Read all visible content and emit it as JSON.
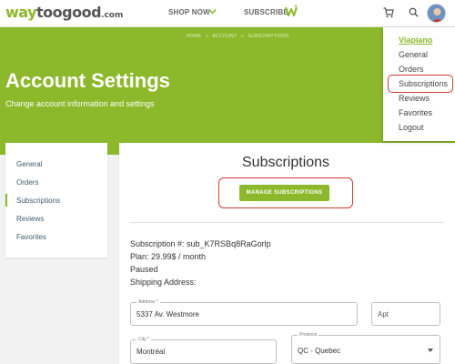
{
  "header": {
    "logo": {
      "part1": "way",
      "part2": "toogood",
      "part3": ".com"
    },
    "nav": {
      "shop_now": "SHOP NOW",
      "subscribe": "SUBSCRIBE"
    },
    "icons": [
      "chevron-down-icon",
      "subscribe-w-icon",
      "cart-icon",
      "search-icon",
      "avatar"
    ]
  },
  "banner": {
    "breadcrumb": [
      "HOME",
      "»",
      "ACCOUNT",
      "»",
      "SUBSCRIPTIONS"
    ],
    "title": "Account Settings",
    "subtitle": "Change account information and settings"
  },
  "dropdown": {
    "user": "Viapiano",
    "items": [
      "General",
      "Orders",
      "Subscriptions",
      "Reviews",
      "Favorites",
      "Logout"
    ],
    "highlighted": "Subscriptions"
  },
  "side_nav": {
    "items": [
      "General",
      "Orders",
      "Subscriptions",
      "Reviews",
      "Favorites"
    ],
    "active": "Subscriptions"
  },
  "panel": {
    "title": "Subscriptions",
    "manage_button": "MANAGE SUBSCRIPTIONS",
    "subscription_number": "Subscription #: sub_K7RSBq8RaGorlp",
    "plan": "Plan: 29.99$ / month",
    "status": "Paused",
    "shipping_label": "Shipping Address:"
  },
  "form": {
    "address": {
      "label": "Address *",
      "value": "5337 Av. Westmore"
    },
    "apt": {
      "label": "",
      "value": "Apt"
    },
    "city": {
      "label": "City *",
      "value": "Montréal"
    },
    "province": {
      "label": "Province",
      "value": "QC - Quebec"
    }
  },
  "colors": {
    "brand_green": "#8cb82b",
    "highlight_red": "#d23a2e"
  }
}
